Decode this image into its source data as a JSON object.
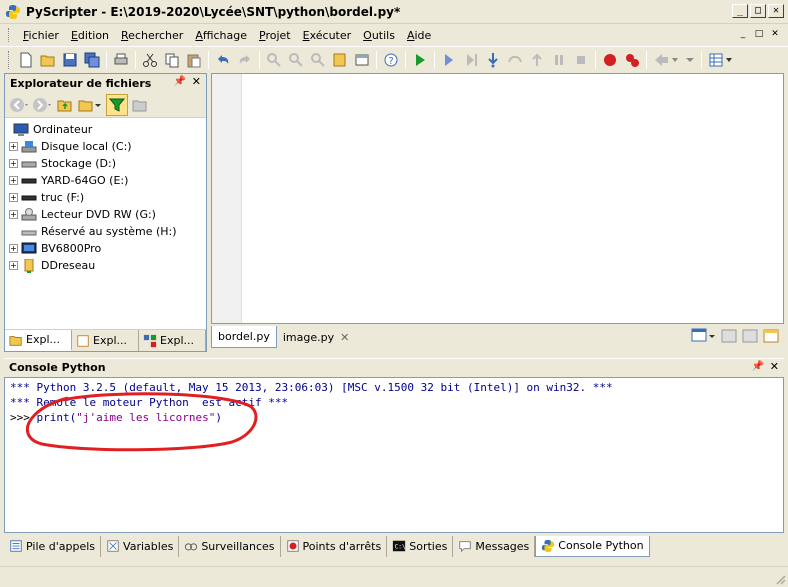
{
  "window": {
    "title": "PyScripter - E:\\2019-2020\\Lycée\\SNT\\python\\bordel.py*",
    "minimize": "_",
    "maximize": "□",
    "close": "✕"
  },
  "menu": [
    "Fichier",
    "Edition",
    "Rechercher",
    "Affichage",
    "Projet",
    "Exécuter",
    "Outils",
    "Aide"
  ],
  "explorer": {
    "title": "Explorateur de fichiers",
    "tree": [
      {
        "label": "Ordinateur",
        "icon": "computer-icon",
        "root": true
      },
      {
        "label": "Disque local (C:)",
        "icon": "hard-drive-icon"
      },
      {
        "label": "Stockage (D:)",
        "icon": "drive-icon"
      },
      {
        "label": "YARD-64GO (E:)",
        "icon": "drive-icon"
      },
      {
        "label": "truc (F:)",
        "icon": "drive-icon"
      },
      {
        "label": "Lecteur DVD RW (G:)",
        "icon": "dvd-drive-icon"
      },
      {
        "label": "Réservé au système (H:)",
        "icon": "drive-icon",
        "noexp": true
      },
      {
        "label": "BV6800Pro",
        "icon": "phone-icon"
      },
      {
        "label": "DDreseau",
        "icon": "folder-icon"
      }
    ],
    "tabs": [
      "Expl...",
      "Expl...",
      "Expl..."
    ]
  },
  "editor": {
    "tabs": [
      {
        "label": "bordel.py",
        "active": true
      },
      {
        "label": "image.py",
        "active": false
      }
    ],
    "tab_close": "✕"
  },
  "console": {
    "title": "Console Python",
    "line1": "*** Python 3.2.5 (default, May 15 2013, 23:06:03) [MSC v.1500 32 bit (Intel)] on win32. ***",
    "line2": "*** Remote le moteur Python  est actif ***",
    "prompt": ">>> ",
    "code_prefix": "print(",
    "code_string": "\"j'aime les licornes\"",
    "code_suffix": ")"
  },
  "bottom_tabs": [
    {
      "label": "Pile d'appels",
      "icon": "call-stack-icon"
    },
    {
      "label": "Variables",
      "icon": "variables-icon"
    },
    {
      "label": "Surveillances",
      "icon": "watches-icon"
    },
    {
      "label": "Points d'arrêts",
      "icon": "breakpoints-icon"
    },
    {
      "label": "Sorties",
      "icon": "output-icon"
    },
    {
      "label": "Messages",
      "icon": "messages-icon"
    },
    {
      "label": "Console Python",
      "icon": "python-console-icon",
      "active": true
    }
  ],
  "colors": {
    "chrome": "#ece9d8",
    "border": "#7f9db9",
    "annotation": "#e02020"
  }
}
